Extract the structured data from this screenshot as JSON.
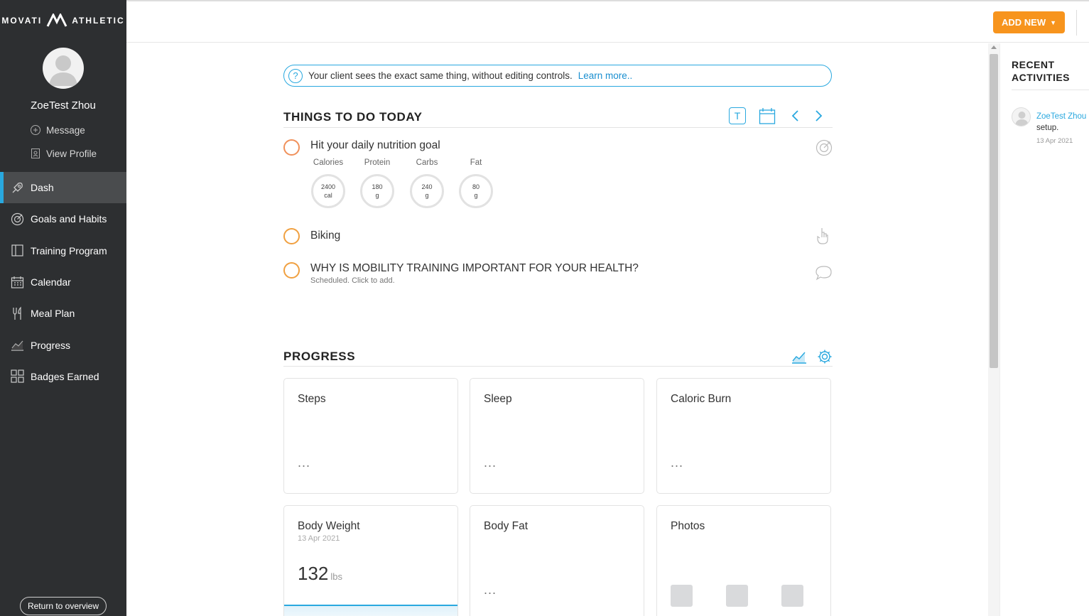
{
  "brand": {
    "left": "MOVATI",
    "right": "ATHLETIC"
  },
  "user": {
    "name": "ZoeTest Zhou",
    "message_label": "Message",
    "view_profile_label": "View Profile"
  },
  "nav": [
    {
      "label": "Dash",
      "icon": "rocket-icon",
      "active": true
    },
    {
      "label": "Goals and Habits",
      "icon": "target-icon"
    },
    {
      "label": "Training Program",
      "icon": "book-icon"
    },
    {
      "label": "Calendar",
      "icon": "calendar-icon"
    },
    {
      "label": "Meal Plan",
      "icon": "utensils-icon"
    },
    {
      "label": "Progress",
      "icon": "chart-icon"
    },
    {
      "label": "Badges Earned",
      "icon": "grid-icon"
    }
  ],
  "return_label": "Return to overview",
  "topbar": {
    "add_new_label": "ADD NEW",
    "add_new_caret": "▼",
    "accent": "#f7941d"
  },
  "info": {
    "text": "Your client sees the exact same thing, without editing controls.",
    "link": "Learn more.."
  },
  "todo": {
    "title": "THINGS TO DO TODAY",
    "toolbar": {
      "text_view_label": "T"
    },
    "items": [
      {
        "title": "Hit your daily nutrition goal",
        "subtitle": ""
      },
      {
        "title": "Biking",
        "subtitle": ""
      },
      {
        "title": "WHY IS MOBILITY TRAINING IMPORTANT FOR YOUR HEALTH?",
        "subtitle": "Scheduled. Click to add."
      }
    ],
    "macros": [
      {
        "label": "Calories",
        "value": "2400",
        "unit": "cal"
      },
      {
        "label": "Protein",
        "value": "180",
        "unit": "g"
      },
      {
        "label": "Carbs",
        "value": "240",
        "unit": "g"
      },
      {
        "label": "Fat",
        "value": "80",
        "unit": "g"
      }
    ]
  },
  "progress": {
    "title": "PROGRESS",
    "cards": [
      {
        "title": "Steps",
        "value": "..."
      },
      {
        "title": "Sleep",
        "value": "..."
      },
      {
        "title": "Caloric Burn",
        "value": "..."
      },
      {
        "title": "Body Weight",
        "date": "13 Apr 2021",
        "value": "132",
        "unit": "lbs"
      },
      {
        "title": "Body Fat",
        "value": "..."
      },
      {
        "title": "Photos"
      }
    ]
  },
  "recent": {
    "title": "RECENT ACTIVITIES",
    "items": [
      {
        "name": "ZoeTest Zhou",
        "text": "setup.",
        "date": "13 Apr 2021"
      }
    ]
  },
  "colors": {
    "sidebar_bg": "#2d2f31",
    "accent_blue": "#29a8df",
    "todo_circle": "#f0a040"
  }
}
